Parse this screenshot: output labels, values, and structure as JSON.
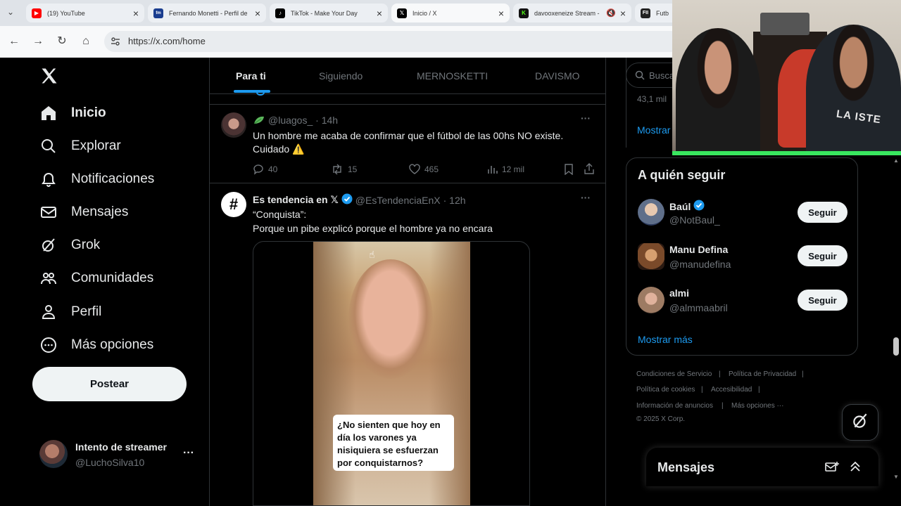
{
  "browser": {
    "tabs": [
      {
        "title": "(19) YouTube",
        "favicon": "youtube-icon",
        "color": "#ff0000"
      },
      {
        "title": "Fernando Monetti - Perfil de",
        "favicon": "fm-icon",
        "color": "#1a3d8f"
      },
      {
        "title": "TikTok - Make Your Day",
        "favicon": "tiktok-icon",
        "color": "#000000"
      },
      {
        "title": "Inicio / X",
        "favicon": "x-icon",
        "color": "#000000"
      },
      {
        "title": "davooxeneize Stream -",
        "favicon": "kick-icon",
        "color": "#53fc18"
      },
      {
        "title": "Futb",
        "favicon": "futbol-icon",
        "color": "#222222"
      }
    ],
    "url": "https://x.com/home"
  },
  "sidebar": {
    "items": [
      {
        "label": "Inicio",
        "icon": "home-icon"
      },
      {
        "label": "Explorar",
        "icon": "search-icon"
      },
      {
        "label": "Notificaciones",
        "icon": "bell-icon"
      },
      {
        "label": "Mensajes",
        "icon": "mail-icon"
      },
      {
        "label": "Grok",
        "icon": "grok-icon"
      },
      {
        "label": "Comunidades",
        "icon": "communities-icon"
      },
      {
        "label": "Perfil",
        "icon": "person-icon"
      },
      {
        "label": "Más opciones",
        "icon": "more-circle-icon"
      }
    ],
    "post_label": "Postear",
    "account": {
      "name": "Intento de streamer",
      "handle": "@LuchoSilva10",
      "more": "···"
    }
  },
  "feed": {
    "tabs": [
      "Para ti",
      "Siguiendo",
      "MERNOSKETTI",
      "DAVISMO"
    ],
    "posts": [
      {
        "handle": "@luagos_",
        "time": "· 14h",
        "text_line1": "Un hombre me acaba de confirmar que el fútbol de las 00hs NO existe.",
        "text_line2": "Cuidado ⚠️",
        "replies": "40",
        "reposts": "15",
        "likes": "465",
        "views": "12 mil"
      },
      {
        "name": "Es tendencia en 𝕏",
        "handle": "@EsTendenciaEnX",
        "time": "· 12h",
        "text_line1": "“Conquista”:",
        "text_line2": "Porque un pibe explicó porque el hombre ya no encara",
        "video_caption": "¿No sienten que hoy en día los varones ya nisiquiera se esfuerzan por conquistarnos?"
      }
    ],
    "more": "···"
  },
  "right": {
    "search_placeholder": "Busca",
    "trend_count": "43,1 mil",
    "show_more_top": "Mostrar",
    "who_to_follow": {
      "title": "A quién seguir",
      "users": [
        {
          "name": "Baúl",
          "handle": "@NotBaul_",
          "verified": true,
          "button": "Seguir"
        },
        {
          "name": "Manu Defina",
          "handle": "@manudefina",
          "verified": false,
          "button": "Seguir"
        },
        {
          "name": "almi",
          "handle": "@almmaabril",
          "verified": false,
          "button": "Seguir"
        }
      ],
      "show_more": "Mostrar más"
    },
    "footer": {
      "links": [
        "Condiciones de Servicio",
        "Política de Privacidad",
        "Política de cookies",
        "Accesibilidad",
        "Información de anuncios",
        "Más opciones ···"
      ],
      "copyright": "© 2025 X Corp."
    },
    "messages_title": "Mensajes"
  },
  "colors": {
    "accent": "#1d9bf0",
    "border": "#2f3336",
    "muted": "#71767b",
    "webcam_border": "#39e75f"
  }
}
